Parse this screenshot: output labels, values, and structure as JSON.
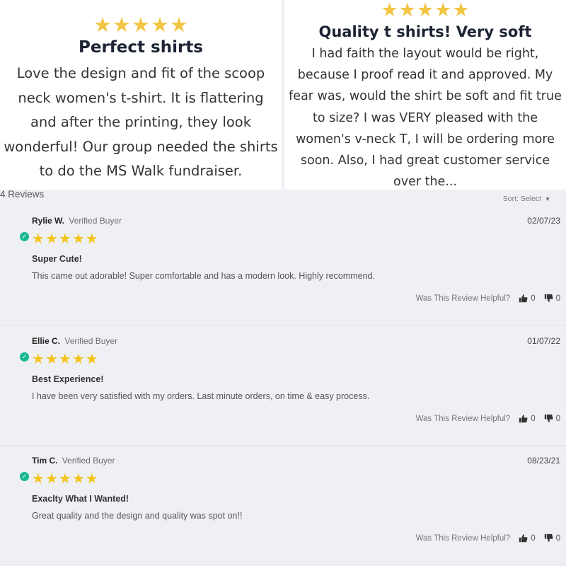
{
  "featured": [
    {
      "stars": 5,
      "title": "Perfect shirts",
      "body": "Love the design and fit of the scoop neck women's t-shirt. It is flattering and after the printing, they look wonderful! Our group needed the shirts to do the MS Walk fundraiser."
    },
    {
      "stars": 5,
      "title": "Quality t shirts! Very soft",
      "body": "I had faith the layout would be right, because I proof read it and approved. My fear was, would the shirt be soft and fit true to size? I was VERY pleased with the women's v-neck T, I will be ordering more soon. Also, I had great customer service over the..."
    }
  ],
  "reviews_header": {
    "count_label": "4 Reviews",
    "sort_label": "Sort: Select"
  },
  "reviews": [
    {
      "author": "Rylie W.",
      "badge": "Verified Buyer",
      "date": "02/07/23",
      "stars": 5,
      "title": "Super Cute!",
      "body": "This came out adorable! Super comfortable and has a modern look. Highly recommend.",
      "helpful_label": "Was This Review Helpful?",
      "up": "0",
      "down": "0"
    },
    {
      "author": "Ellie C.",
      "badge": "Verified Buyer",
      "date": "01/07/22",
      "stars": 5,
      "title": "Best Experience!",
      "body": "I have been very satisfied with my orders. Last minute orders, on time & easy process.",
      "helpful_label": "Was This Review Helpful?",
      "up": "0",
      "down": "0"
    },
    {
      "author": "Tim C.",
      "badge": "Verified Buyer",
      "date": "08/23/21",
      "stars": 5,
      "title": "Exaclty What I Wanted!",
      "body": "Great quality and the design and quality was spot on!!",
      "helpful_label": "Was This Review Helpful?",
      "up": "0",
      "down": "0"
    }
  ],
  "colors": {
    "star_featured": "#f3c544",
    "star_review": "#f4c41b",
    "verified_check": "#19b990",
    "page_background": "#eff0f4"
  }
}
